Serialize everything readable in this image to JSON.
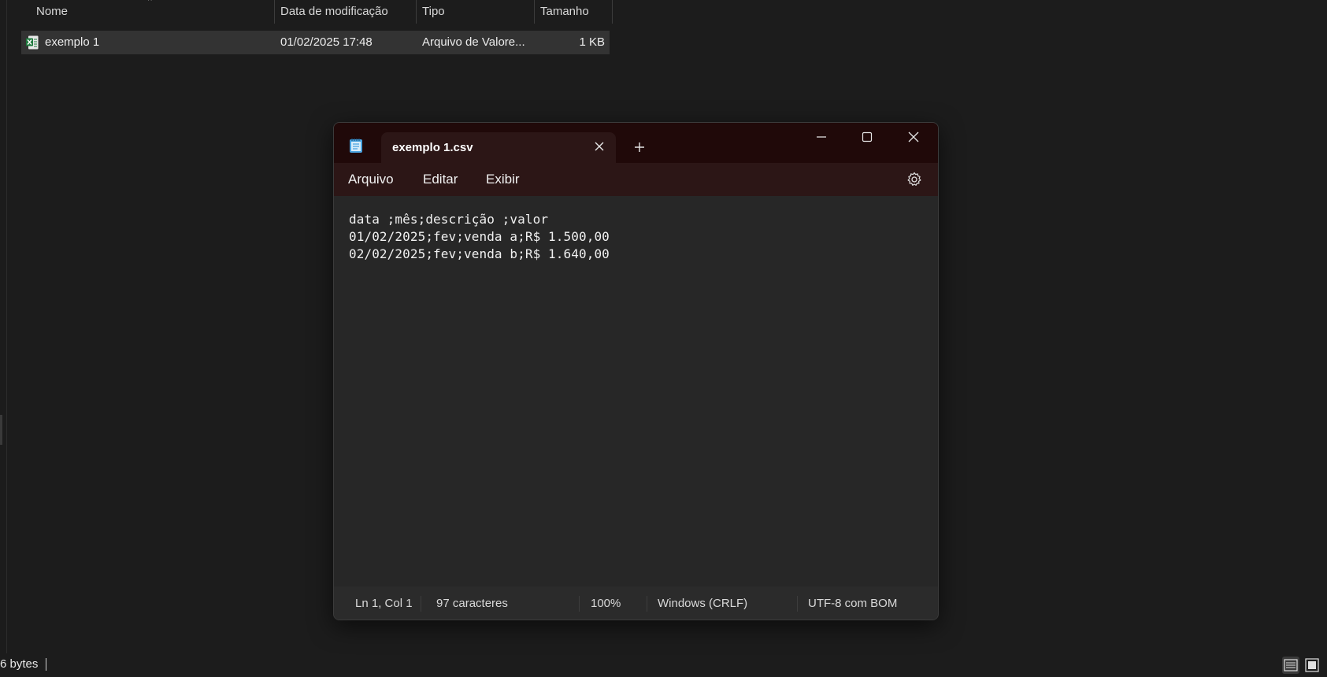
{
  "explorer": {
    "columns": [
      "Nome",
      "Data de modificação",
      "Tipo",
      "Tamanho"
    ],
    "rows": [
      {
        "name": "exemplo 1",
        "modified": "01/02/2025 17:48",
        "type": "Arquivo de Valore...",
        "size": "1 KB"
      }
    ],
    "status_text": "6 bytes"
  },
  "notepad": {
    "tab_title": "exemplo 1.csv",
    "menu": [
      "Arquivo",
      "Editar",
      "Exibir"
    ],
    "lines": [
      "data ;mês;descrição ;valor",
      "01/02/2025;fev;venda a;R$ 1.500,00",
      "02/02/2025;fev;venda b;R$ 1.640,00"
    ],
    "status": {
      "position": "Ln 1, Col 1",
      "chars": "97 caracteres",
      "zoom": "100%",
      "line_ending": "Windows (CRLF)",
      "encoding": "UTF-8 com BOM"
    }
  },
  "colors": {
    "titlebar": "#200909",
    "menubar": "#2c1616",
    "editor_bg": "#272727",
    "explorer_bg": "#1c1c1c",
    "excel_green": "#1f7a3e"
  },
  "icons": [
    "excel-csv-file-icon",
    "notepad-app-icon",
    "close-icon",
    "plus-icon",
    "minimize-icon",
    "maximize-icon",
    "gear-icon",
    "details-view-icon",
    "large-icons-view-icon"
  ]
}
